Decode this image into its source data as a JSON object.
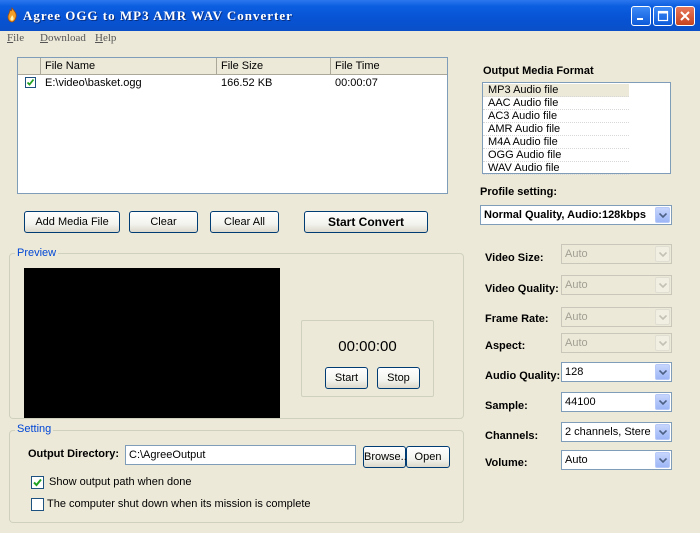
{
  "window": {
    "title": "Agree OGG to MP3 AMR WAV Converter"
  },
  "menu": {
    "items": [
      "File",
      "Download",
      "Help"
    ]
  },
  "filelist": {
    "columns": [
      "File Name",
      "File Size",
      "File Time"
    ],
    "rows": [
      {
        "checked": true,
        "name": "E:\\video\\basket.ogg",
        "size": "166.52 KB",
        "time": "00:00:07"
      }
    ]
  },
  "buttons": {
    "add_media": "Add Media File",
    "clear": "Clear",
    "clear_all": "Clear All",
    "start_convert": "Start Convert"
  },
  "preview": {
    "title": "Preview",
    "time": "00:00:00",
    "start": "Start",
    "stop": "Stop"
  },
  "setting": {
    "title": "Setting",
    "output_dir_label": "Output Directory:",
    "output_dir_value": "C:\\AgreeOutput",
    "browse": "Browse..",
    "open": "Open",
    "show_path_label": "Show output path when done",
    "show_path_checked": true,
    "shutdown_label": "The computer shut down when its mission is complete",
    "shutdown_checked": false
  },
  "output_format": {
    "title": "Output Media Format",
    "items": [
      "MP3 Audio file",
      "AAC Audio file",
      "AC3 Audio file",
      "AMR Audio file",
      "M4A Audio file",
      "OGG Audio file",
      "WAV Audio file"
    ],
    "selected": 0
  },
  "profile": {
    "label": "Profile setting:",
    "value": "Normal Quality, Audio:128kbps"
  },
  "params": {
    "video_size": {
      "label": "Video Size:",
      "value": "Auto"
    },
    "video_quality": {
      "label": "Video Quality:",
      "value": "Auto"
    },
    "frame_rate": {
      "label": "Frame Rate:",
      "value": "Auto"
    },
    "aspect": {
      "label": "Aspect:",
      "value": "Auto"
    },
    "audio_quality": {
      "label": "Audio Quality:",
      "value": "128"
    },
    "sample": {
      "label": "Sample:",
      "value": "44100"
    },
    "channels": {
      "label": "Channels:",
      "value": "2 channels, Stere"
    },
    "volume": {
      "label": "Volume:",
      "value": "Auto"
    }
  },
  "colors": {
    "titlebar": "#0a54d6",
    "face": "#ece9d8",
    "group_title": "#0046d5",
    "border": "#7f9db9"
  }
}
